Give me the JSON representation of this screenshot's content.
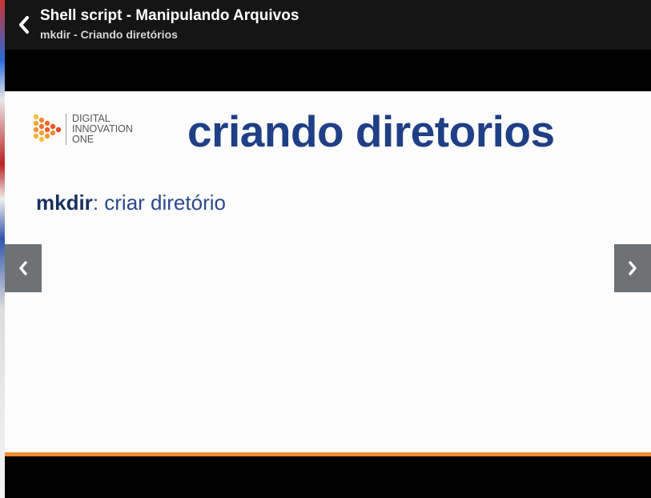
{
  "header": {
    "title": "Shell script - Manipulando Arquivos",
    "subtitle": "mkdir - Criando diretórios",
    "back_icon": "chevron-left-icon"
  },
  "slide": {
    "logo_lines": [
      "DIGITAL",
      "INNOVATION",
      "ONE"
    ],
    "heading": "criando diretorios",
    "command": "mkdir",
    "command_desc": ": criar diretório",
    "accent_color": "#f28a2e",
    "heading_color": "#1f3f86"
  },
  "navigation": {
    "prev_icon": "chevron-left-icon",
    "next_icon": "chevron-right-icon"
  }
}
